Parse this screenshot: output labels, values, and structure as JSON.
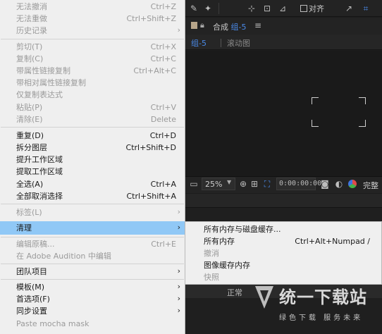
{
  "menu": {
    "items": [
      {
        "label": "无法撤消",
        "shortcut": "Ctrl+Z",
        "enabled": false
      },
      {
        "label": "无法重做",
        "shortcut": "Ctrl+Shift+Z",
        "enabled": false
      },
      {
        "label": "历史记录",
        "arrow": "›",
        "enabled": false
      },
      {
        "label": "剪切(T)",
        "shortcut": "Ctrl+X",
        "enabled": false
      },
      {
        "label": "复制(C)",
        "shortcut": "Ctrl+C",
        "enabled": false
      },
      {
        "label": "带属性链接复制",
        "shortcut": "Ctrl+Alt+C",
        "enabled": false
      },
      {
        "label": "带相对属性链接复制",
        "enabled": false
      },
      {
        "label": "仅复制表达式",
        "enabled": false
      },
      {
        "label": "粘贴(P)",
        "shortcut": "Ctrl+V",
        "enabled": false
      },
      {
        "label": "清除(E)",
        "shortcut": "Delete",
        "enabled": false
      },
      {
        "label": "重复(D)",
        "shortcut": "Ctrl+D",
        "enabled": true
      },
      {
        "label": "拆分图层",
        "shortcut": "Ctrl+Shift+D",
        "enabled": true
      },
      {
        "label": "提升工作区域",
        "enabled": true
      },
      {
        "label": "提取工作区域",
        "enabled": true
      },
      {
        "label": "全选(A)",
        "shortcut": "Ctrl+A",
        "enabled": true
      },
      {
        "label": "全部取消选择",
        "shortcut": "Ctrl+Shift+A",
        "enabled": true
      },
      {
        "label": "标签(L)",
        "arrow": "›",
        "enabled": false
      },
      {
        "label": "清理",
        "arrow": "›",
        "enabled": true,
        "highlighted": true
      },
      {
        "label": "编辑原稿...",
        "shortcut": "Ctrl+E",
        "enabled": false
      },
      {
        "label": "在 Adobe Audition 中编辑",
        "enabled": false
      },
      {
        "label": "团队项目",
        "arrow": "›",
        "enabled": true
      },
      {
        "label": "模板(M)",
        "arrow": "›",
        "enabled": true
      },
      {
        "label": "首选项(F)",
        "arrow": "›",
        "enabled": true
      },
      {
        "label": "同步设置",
        "arrow": "›",
        "enabled": true
      },
      {
        "label": "Paste mocha mask",
        "enabled": false
      }
    ]
  },
  "submenu": {
    "items": [
      {
        "label": "所有内存与磁盘缓存...",
        "enabled": true
      },
      {
        "label": "所有内存",
        "shortcut": "Ctrl+Alt+Numpad /",
        "enabled": true
      },
      {
        "label": "撤消",
        "enabled": false
      },
      {
        "label": "图像缓存内存",
        "enabled": true
      },
      {
        "label": "快照",
        "enabled": false
      }
    ]
  },
  "toolbar": {
    "align_label": "对齐"
  },
  "composition": {
    "title_prefix": "合成",
    "title_name": "组-5",
    "menu_glyph": "≡",
    "tab_active": "组-5",
    "tab_other": "滚动图"
  },
  "viewer": {
    "zoom": "25%",
    "timecode": "0:00:00:00",
    "full_label": "完整"
  },
  "timeline": {
    "mode": "正常"
  },
  "watermark": {
    "title": "统一下载站",
    "subtitle": "绿色下载 服务未来"
  },
  "colors": {
    "menu_bg": "#efefef",
    "highlight": "#90c8f6",
    "accent_blue": "#4a8ae8",
    "app_bg": "#1d1d1d"
  }
}
